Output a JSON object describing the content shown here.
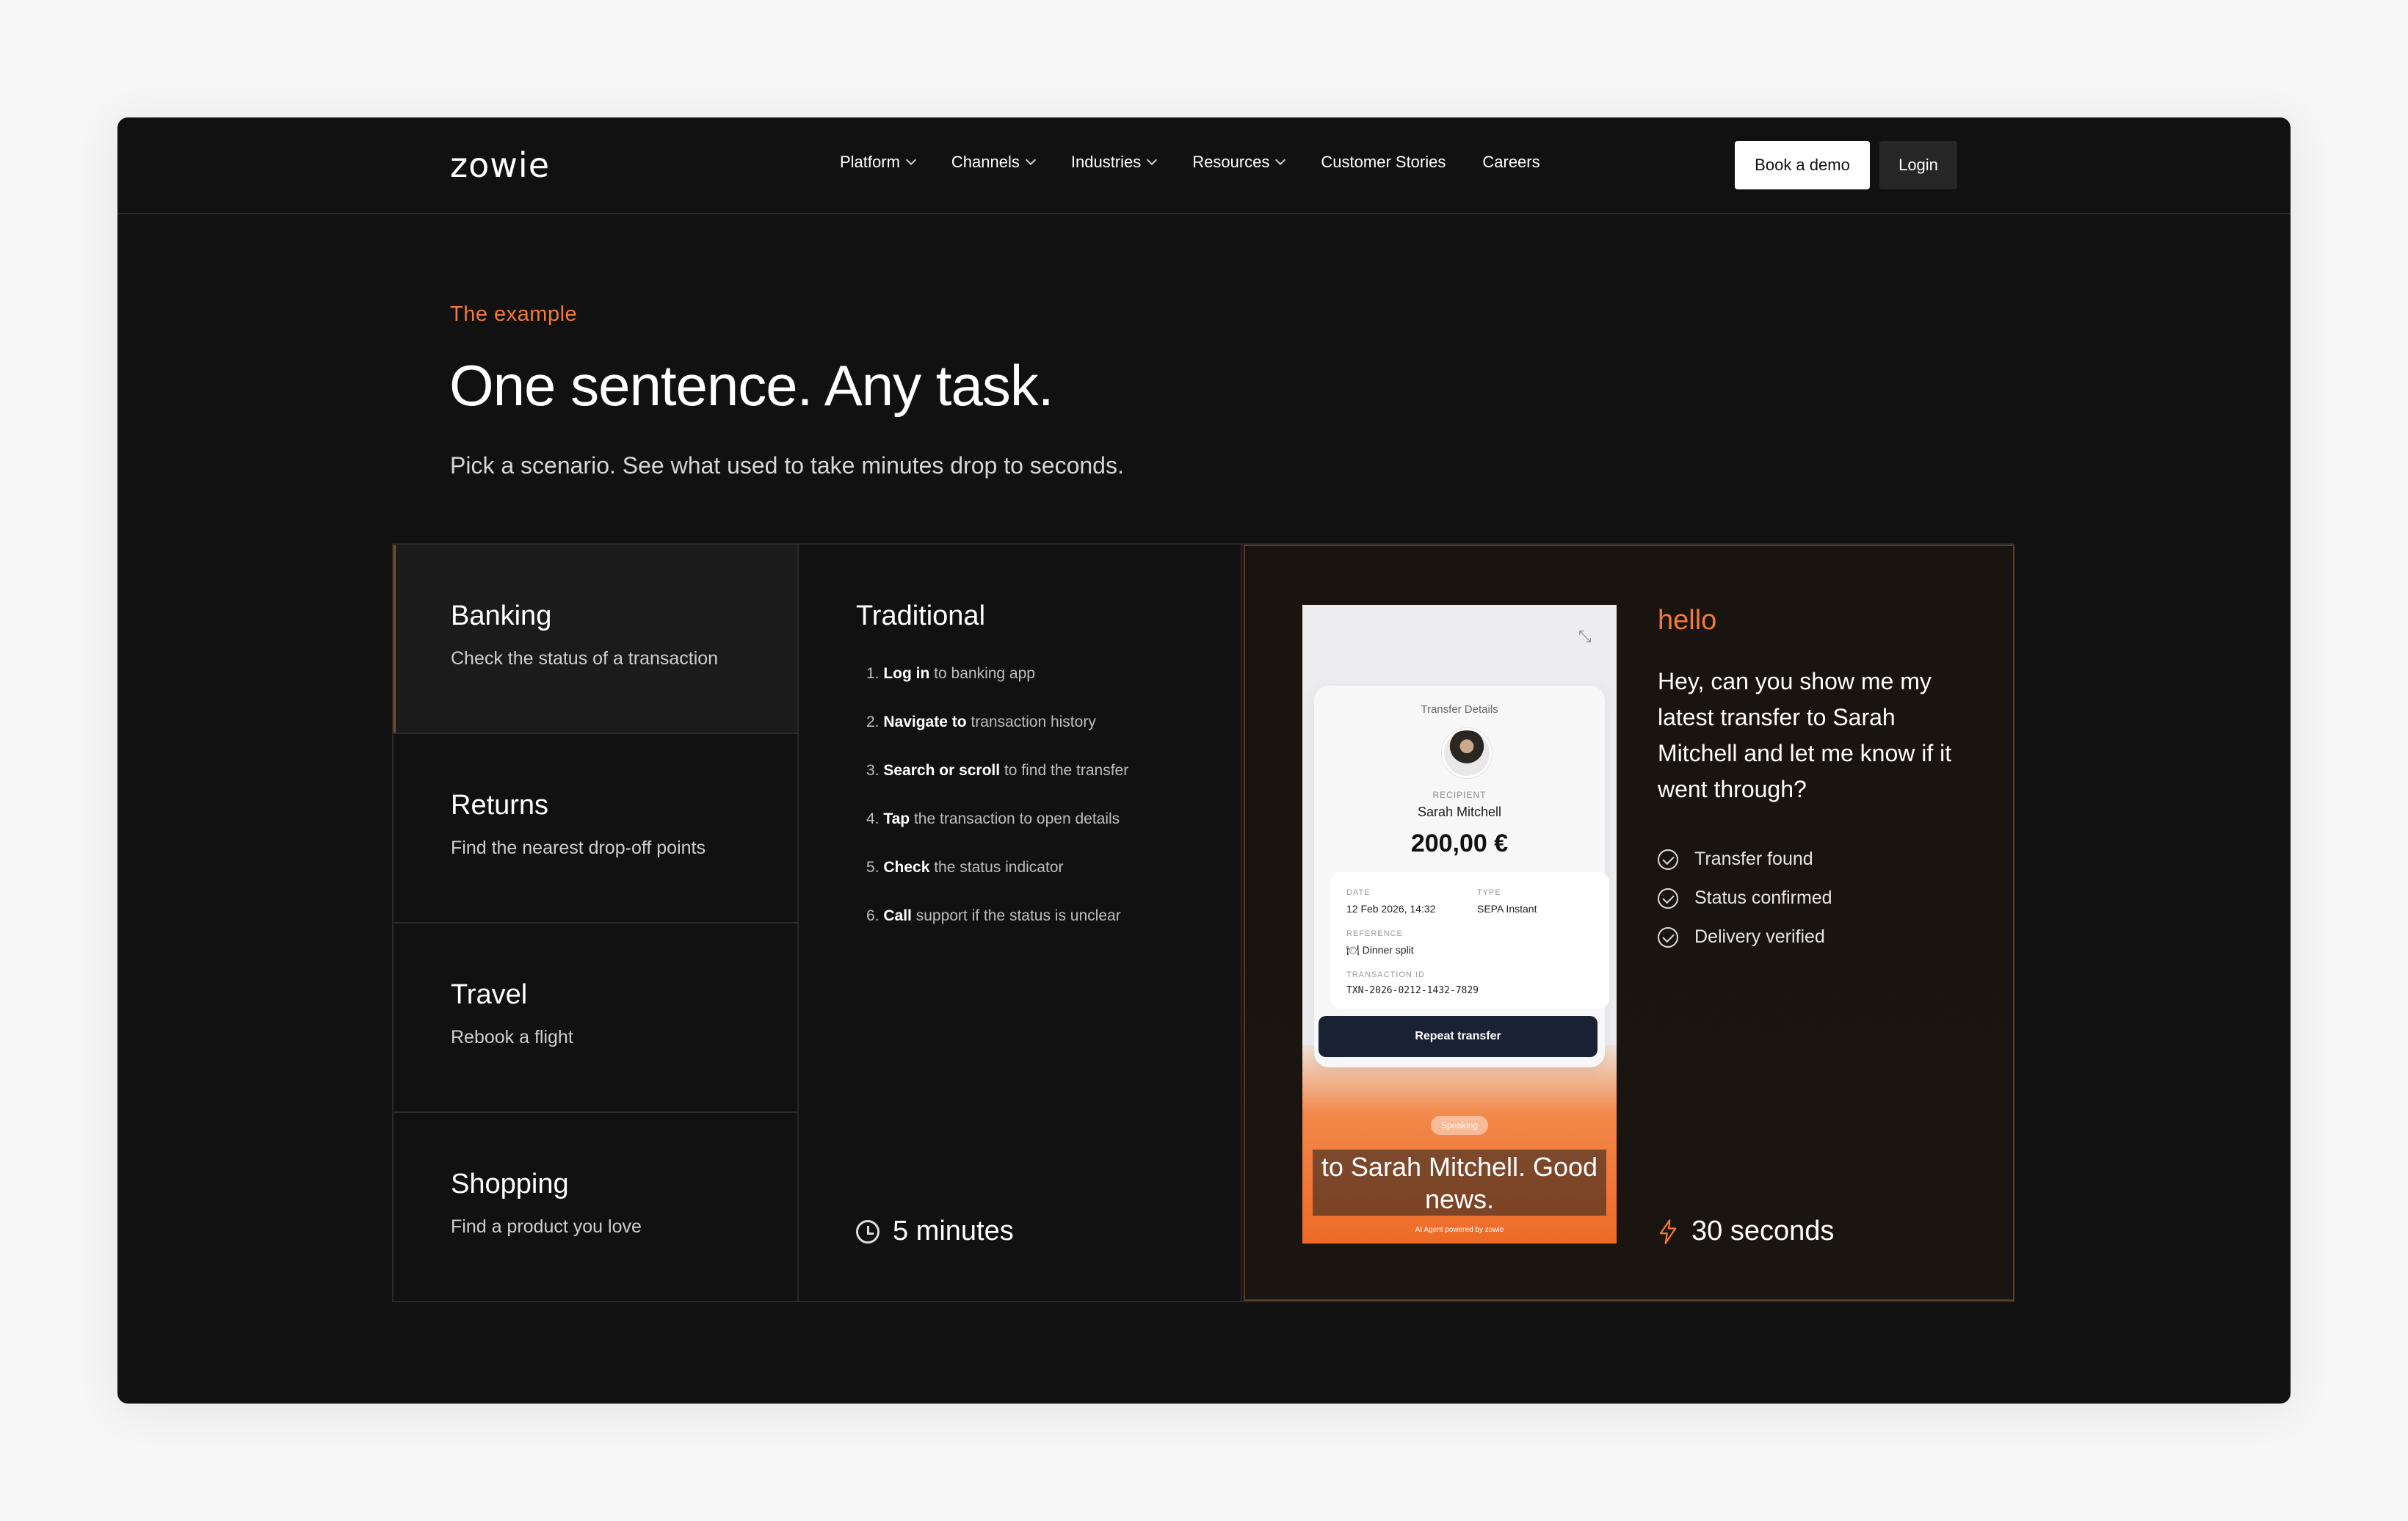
{
  "brand": {
    "logo": "zowie"
  },
  "nav": {
    "items": [
      {
        "label": "Platform",
        "dropdown": true
      },
      {
        "label": "Channels",
        "dropdown": true
      },
      {
        "label": "Industries",
        "dropdown": true
      },
      {
        "label": "Resources",
        "dropdown": true
      },
      {
        "label": "Customer Stories",
        "dropdown": false
      },
      {
        "label": "Careers",
        "dropdown": false
      }
    ],
    "book_demo": "Book a demo",
    "login": "Login"
  },
  "hero": {
    "eyebrow": "The example",
    "headline": "One sentence. Any task.",
    "sub": "Pick a scenario. See what used to take minutes drop to seconds."
  },
  "scenarios": [
    {
      "title": "Banking",
      "desc": "Check the status of a transaction",
      "active": true
    },
    {
      "title": "Returns",
      "desc": "Find the nearest drop-off points",
      "active": false
    },
    {
      "title": "Travel",
      "desc": "Rebook a flight",
      "active": false
    },
    {
      "title": "Shopping",
      "desc": "Find a product you love",
      "active": false
    }
  ],
  "traditional": {
    "title": "Traditional",
    "steps": [
      {
        "n": "1.",
        "bold": "Log in",
        "rest": " to banking app"
      },
      {
        "n": "2.",
        "bold": "Navigate to",
        "rest": " transaction history"
      },
      {
        "n": "3.",
        "bold": "Search or scroll",
        "rest": " to find the transfer"
      },
      {
        "n": "4.",
        "bold": "Tap",
        "rest": " the transaction to open details"
      },
      {
        "n": "5.",
        "bold": "Check",
        "rest": " the status indicator"
      },
      {
        "n": "6.",
        "bold": "Call",
        "rest": " support if the status is unclear"
      }
    ],
    "time": "5 minutes"
  },
  "phone": {
    "card_title": "Transfer Details",
    "recipient_label": "RECIPIENT",
    "recipient_name": "Sarah Mitchell",
    "amount": "200,00 €",
    "date_label": "DATE",
    "date_value": "12 Feb 2026, 14:32",
    "type_label": "TYPE",
    "type_value": "SEPA Instant",
    "reference_label": "REFERENCE",
    "reference_value": "🍽 Dinner split",
    "txn_label": "TRANSACTION ID",
    "txn_value": "TXN-2026-0212-1432-7829",
    "repeat_button": "Repeat transfer",
    "speaking": "Speaking",
    "caption": "to Sarah Mitchell. Good news.",
    "powered": "AI Agent powered by zowie"
  },
  "agent": {
    "hello": "hello",
    "prompt": "Hey, can you show me my latest transfer to Sarah Mitchell and let me know if it went through?",
    "checks": [
      "Transfer found",
      "Status confirmed",
      "Delivery verified"
    ],
    "time": "30 seconds"
  },
  "colors": {
    "accent": "#f07a3a",
    "background": "#111111",
    "page": "#f6f6f6"
  }
}
